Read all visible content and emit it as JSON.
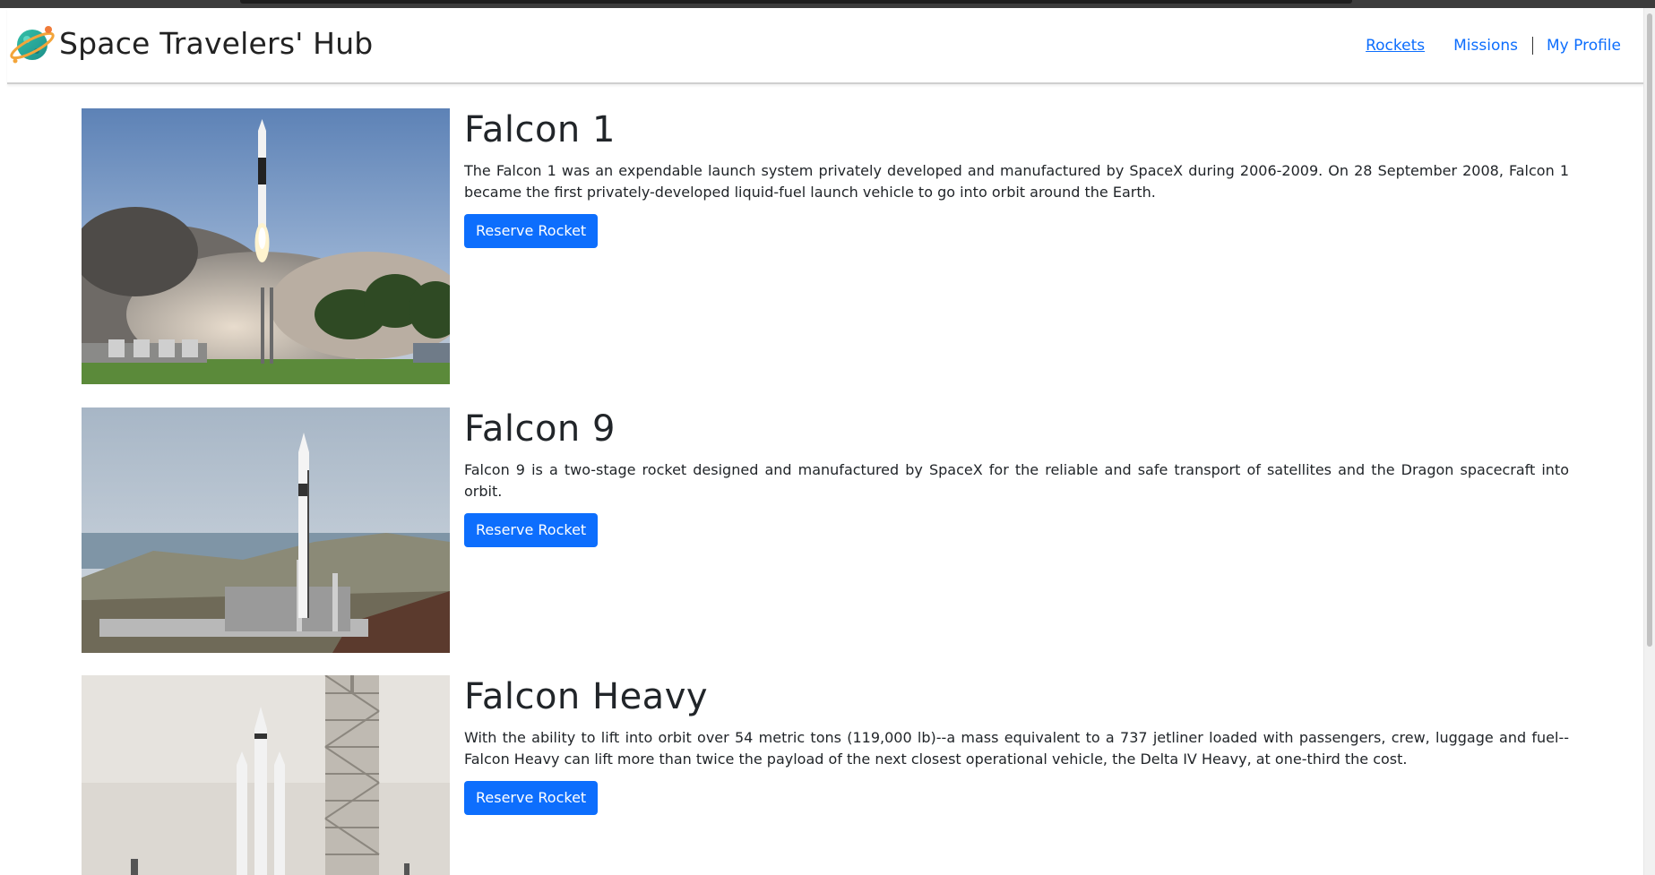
{
  "header": {
    "brand": "Space Travelers' Hub",
    "logo_icon": "planet-icon",
    "nav": {
      "rockets": "Rockets",
      "missions": "Missions",
      "profile": "My Profile"
    }
  },
  "rockets": [
    {
      "name": "Falcon 1",
      "description": "The Falcon 1 was an expendable launch system privately developed and manufactured by SpaceX during 2006-2009. On 28 September 2008, Falcon 1 became the first privately-developed liquid-fuel launch vehicle to go into orbit around the Earth.",
      "button": "Reserve Rocket"
    },
    {
      "name": "Falcon 9",
      "description": "Falcon 9 is a two-stage rocket designed and manufactured by SpaceX for the reliable and safe transport of satellites and the Dragon spacecraft into orbit.",
      "button": "Reserve Rocket"
    },
    {
      "name": "Falcon Heavy",
      "description": "With the ability to lift into orbit over 54 metric tons (119,000 lb)--a mass equivalent to a 737 jetliner loaded with passengers, crew, luggage and fuel--Falcon Heavy can lift more than twice the payload of the next closest operational vehicle, the Delta IV Heavy, at one-third the cost.",
      "button": "Reserve Rocket"
    }
  ],
  "colors": {
    "accent": "#0d6efd",
    "text": "#212529"
  }
}
